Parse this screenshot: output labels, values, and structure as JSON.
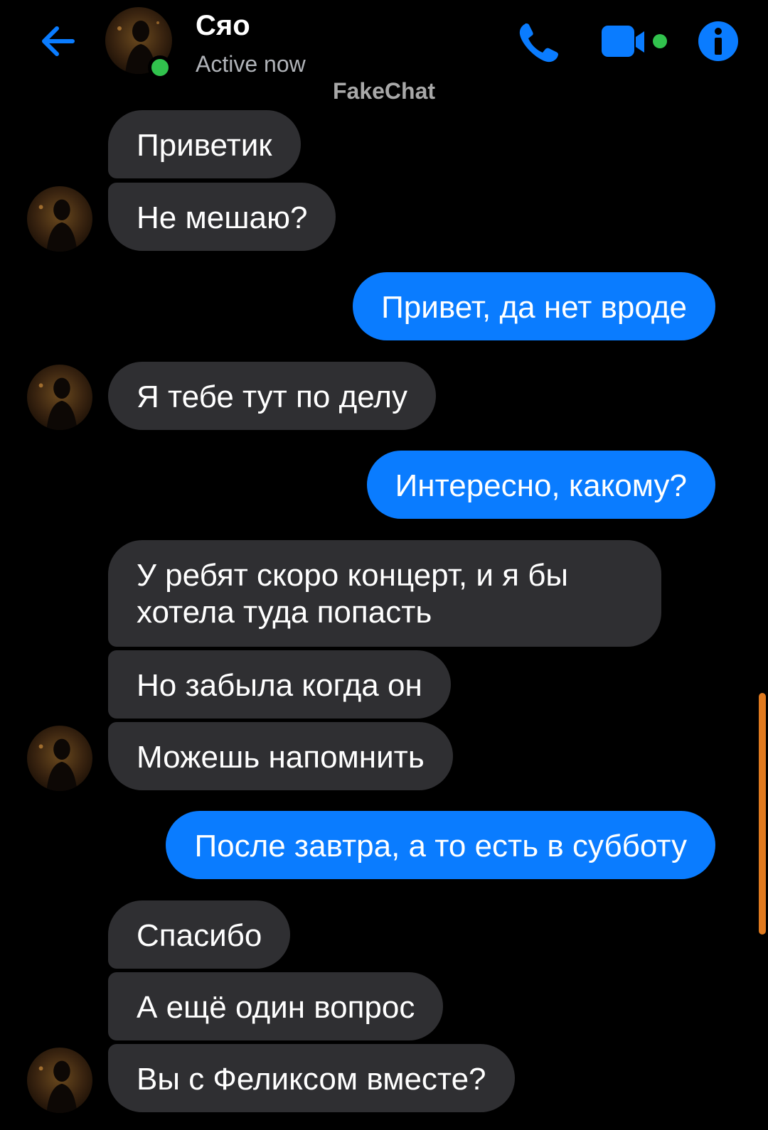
{
  "header": {
    "contact_name": "Сяо",
    "status": "Active now",
    "watermark": "FakeChat",
    "icons": {
      "back": "back-arrow-icon",
      "call": "phone-icon",
      "video": "video-camera-icon",
      "info": "info-icon"
    }
  },
  "colors": {
    "background": "#000000",
    "incoming_bubble": "#2f2f32",
    "outgoing_bubble": "#0a7cff",
    "accent": "#0a7cff",
    "online": "#31c24d",
    "scrollbar": "#e07a1f"
  },
  "messages": [
    {
      "side": "in",
      "text": "Приветик"
    },
    {
      "side": "in",
      "text": "Не мешаю?"
    },
    {
      "side": "out",
      "text": "Привет, да нет вроде"
    },
    {
      "side": "in",
      "text": "Я тебе тут по делу"
    },
    {
      "side": "out",
      "text": "Интересно, какому?"
    },
    {
      "side": "in",
      "text": "У ребят скоро концерт, и я бы хотела туда попасть"
    },
    {
      "side": "in",
      "text": "Но забыла когда он"
    },
    {
      "side": "in",
      "text": "Можешь напомнить"
    },
    {
      "side": "out",
      "text": "После завтра, а то есть в субботу"
    },
    {
      "side": "in",
      "text": "Спасибо"
    },
    {
      "side": "in",
      "text": "А ещё один вопрос"
    },
    {
      "side": "in",
      "text": "Вы с Феликсом вместе?"
    }
  ]
}
